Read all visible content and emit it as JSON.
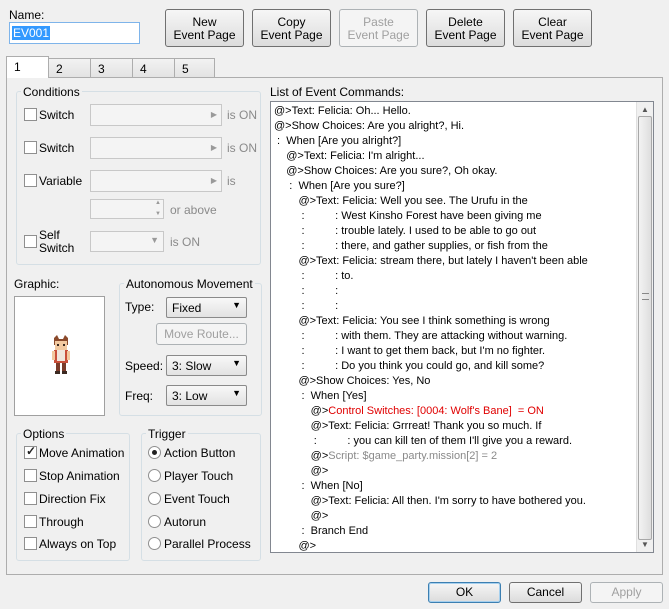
{
  "name": {
    "label": "Name:",
    "value": "EV001"
  },
  "toolbar": {
    "new": "New\nEvent Page",
    "copy": "Copy\nEvent Page",
    "paste": "Paste\nEvent Page",
    "delete": "Delete\nEvent Page",
    "clear": "Clear\nEvent Page"
  },
  "tabs": [
    "1",
    "2",
    "3",
    "4",
    "5"
  ],
  "conditions": {
    "title": "Conditions",
    "switch1": "Switch",
    "switch2": "Switch",
    "variable": "Variable",
    "self_switch": "Self\nSwitch",
    "is_on": "is ON",
    "is": "is",
    "or_above": "or above"
  },
  "graphic": {
    "title": "Graphic:"
  },
  "autonomous": {
    "title": "Autonomous Movement",
    "type_label": "Type:",
    "type_value": "Fixed",
    "move_route": "Move Route...",
    "speed_label": "Speed:",
    "speed_value": "3: Slow",
    "freq_label": "Freq:",
    "freq_value": "3: Low"
  },
  "options": {
    "title": "Options",
    "items": [
      {
        "label": "Move Animation",
        "checked": true
      },
      {
        "label": "Stop Animation",
        "checked": false
      },
      {
        "label": "Direction Fix",
        "checked": false
      },
      {
        "label": "Through",
        "checked": false
      },
      {
        "label": "Always on Top",
        "checked": false
      }
    ]
  },
  "trigger": {
    "title": "Trigger",
    "items": [
      {
        "label": "Action Button",
        "checked": true
      },
      {
        "label": "Player Touch",
        "checked": false
      },
      {
        "label": "Event Touch",
        "checked": false
      },
      {
        "label": "Autorun",
        "checked": false
      },
      {
        "label": "Parallel Process",
        "checked": false
      }
    ]
  },
  "commands": {
    "title": "List of Event Commands:",
    "lines": [
      {
        "text": "@>Text: Felicia: Oh... Hello."
      },
      {
        "text": "@>Show Choices: Are you alright?, Hi."
      },
      {
        "text": " :  When [Are you alright?]"
      },
      {
        "text": "    @>Text: Felicia: I'm alright..."
      },
      {
        "text": "    @>Show Choices: Are you sure?, Oh okay."
      },
      {
        "text": "     :  When [Are you sure?]"
      },
      {
        "text": "        @>Text: Felicia: Well you see. The Urufu in the"
      },
      {
        "text": "         :          : West Kinsho Forest have been giving me"
      },
      {
        "text": "         :          : trouble lately. I used to be able to go out"
      },
      {
        "text": "         :          : there, and gather supplies, or fish from the"
      },
      {
        "text": "        @>Text: Felicia: stream there, but lately I haven't been able"
      },
      {
        "text": "         :          : to."
      },
      {
        "text": "         :          :"
      },
      {
        "text": "         :          :"
      },
      {
        "text": "        @>Text: Felicia: You see I think something is wrong"
      },
      {
        "text": "         :          : with them. They are attacking without warning."
      },
      {
        "text": "         :          : I want to get them back, but I'm no fighter."
      },
      {
        "text": "         :          : Do you think you could go, and kill some?"
      },
      {
        "text": "        @>Show Choices: Yes, No"
      },
      {
        "text": "         :  When [Yes]"
      },
      {
        "text": "            @>",
        "red": "Control Switches: [0004: Wolf's Bane]  = ON"
      },
      {
        "text": "            @>Text: Felicia: Grrreat! Thank you so much. If"
      },
      {
        "text": "             :          : you can kill ten of them I'll give you a reward."
      },
      {
        "text": "            @>",
        "gray": "Script: $game_party.mission[2] = 2"
      },
      {
        "text": "            @>"
      },
      {
        "text": "         :  When [No]"
      },
      {
        "text": "            @>Text: Felicia: All then. I'm sorry to have bothered you."
      },
      {
        "text": "            @>"
      },
      {
        "text": "         :  Branch End"
      },
      {
        "text": "        @>"
      }
    ]
  },
  "footer": {
    "ok": "OK",
    "cancel": "Cancel",
    "apply": "Apply"
  }
}
